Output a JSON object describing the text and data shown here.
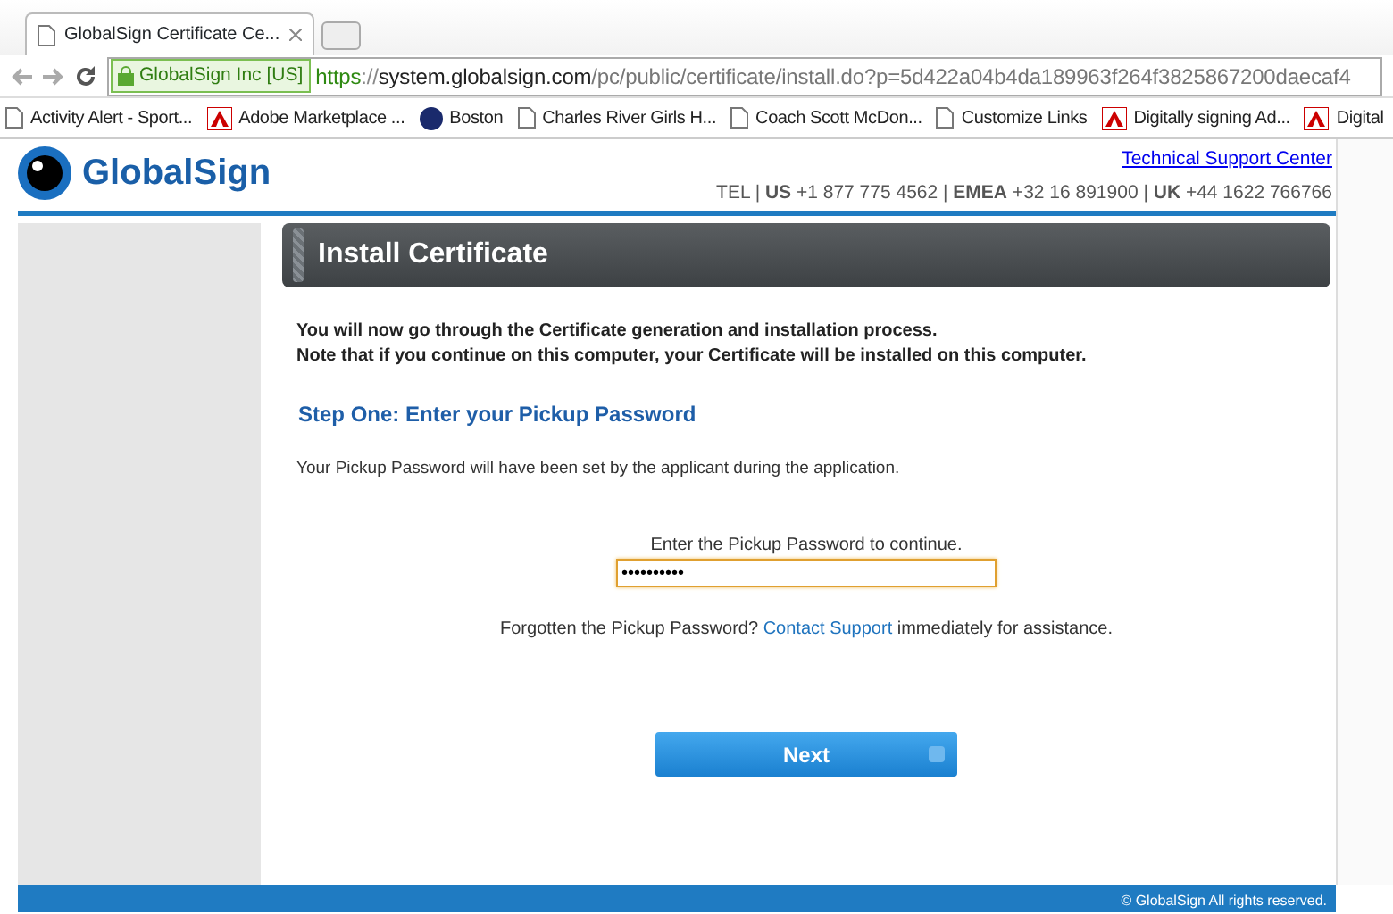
{
  "browser": {
    "tabs": [
      {
        "title": "GlobalSign Certificate Ce...",
        "selected": true
      }
    ],
    "address_bar": {
      "identity": "GlobalSign Inc [US]",
      "scheme": "https",
      "separator": "://",
      "host": "system.globalsign.com",
      "path": "/pc/public/certificate/install.do?p=5d422a04b4da189963f264f3825867200daecaf4"
    },
    "bookmarks": [
      {
        "label": "Activity Alert - Sport...",
        "kind": "page"
      },
      {
        "label": "Adobe Marketplace ...",
        "kind": "adobe"
      },
      {
        "label": "Boston",
        "kind": "b"
      },
      {
        "label": "Charles River Girls H...",
        "kind": "page"
      },
      {
        "label": "Coach Scott McDon...",
        "kind": "page"
      },
      {
        "label": "Customize Links",
        "kind": "page"
      },
      {
        "label": "Digitally signing Ad...",
        "kind": "adobe"
      },
      {
        "label": "Digital",
        "kind": "adobe"
      }
    ]
  },
  "header": {
    "logo": "GlobalSign",
    "support_link": "Technical Support Center",
    "phones": "TEL | **US** +1 877 775 4562 | **EMEA** +32 16 891900 | **UK** +44 1622 766766"
  },
  "panel": {
    "title": "Install Certificate",
    "intro": [
      "You will now go through the Certificate generation and installation process.",
      "Note that if you continue on this computer, your Certificate will be installed on this computer."
    ],
    "step_heading": "Step One: Enter your Pickup Password",
    "step_text": "Your Pickup Password will have been set by the applicant during the application.",
    "field_label": "Enter the Pickup Password to continue.",
    "password": {
      "value": "••••••••••",
      "focused": true
    },
    "help": {
      "before": "Forgotten the Pickup Password?",
      "link": "Contact Support",
      "after": "immediately for assistance."
    },
    "button": "Next"
  },
  "footer": "© GlobalSign All rights reserved."
}
